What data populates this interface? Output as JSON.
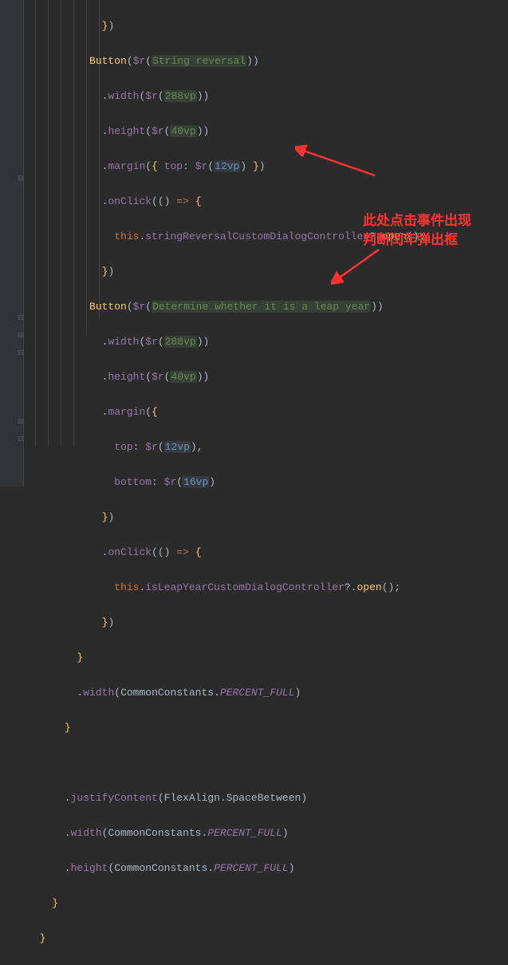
{
  "code": {
    "l1": "})",
    "l2a": "Button",
    "l2b": "$r",
    "l2c": "String reversal",
    "l3a": "width",
    "l3b": "$r",
    "l3c": "288vp",
    "l4a": "height",
    "l4b": "$r",
    "l4c": "40vp",
    "l5a": "margin",
    "l5b": "top",
    "l5c": "$r",
    "l5d": "12vp",
    "l6a": "onClick",
    "l7a": "this",
    "l7b": "stringReversalCustomDialogController",
    "l7c": "open",
    "l8": "})",
    "l9a": "Button",
    "l9b": "$r",
    "l9c": "Determine whether it is a leap year",
    "l10a": "width",
    "l10b": "$r",
    "l10c": "288vp",
    "l11a": "height",
    "l11b": "$r",
    "l11c": "40vp",
    "l12a": "margin",
    "l13a": "top",
    "l13b": "$r",
    "l13c": "12vp",
    "l14a": "bottom",
    "l14b": "$r",
    "l14c": "16vp",
    "l15": "})",
    "l16a": "onClick",
    "l17a": "this",
    "l17b": "isLeapYearCustomDialogController",
    "l17c": "open",
    "l18": "})",
    "l19": "}",
    "l20a": "width",
    "l20b": "CommonConstants",
    "l20c": "PERCENT_FULL",
    "l21": "}",
    "l23a": "justifyContent",
    "l23b": "FlexAlign",
    "l23c": "SpaceBetween",
    "l24a": "width",
    "l24b": "CommonConstants",
    "l24c": "PERCENT_FULL",
    "l25a": "height",
    "l25b": "CommonConstants",
    "l25c": "PERCENT_FULL",
    "l26": "}",
    "l27": "}"
  },
  "annotation": {
    "line1": "此处点击事件出现",
    "line2": "判断闰年弹出框"
  }
}
